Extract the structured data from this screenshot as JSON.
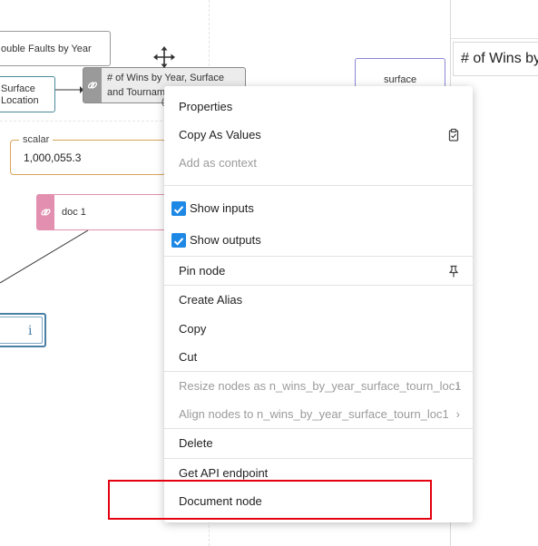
{
  "canvas": {
    "node_double_faults": "ouble Faults by Year",
    "node_surface_location_line1": "Surface",
    "node_surface_location_line2": "Location",
    "node_wins_line1": "# of Wins by Year, Surface",
    "node_wins_line2": "and Tournam",
    "node_wins_line3": "(",
    "node_surface": "surface",
    "scalar_label": "scalar",
    "scalar_value": "1,000,055.3",
    "doc_label": "doc 1",
    "info_glyph": "i"
  },
  "right_panel": {
    "title": "# of Wins by Year, Surface and Tournament Location"
  },
  "context_menu": {
    "properties": "Properties",
    "copy_as_values": "Copy As Values",
    "add_as_context": "Add as context",
    "show_inputs": "Show inputs",
    "show_outputs": "Show outputs",
    "pin_node": "Pin node",
    "create_alias": "Create Alias",
    "copy": "Copy",
    "cut": "Cut",
    "resize_nodes": "Resize nodes as n_wins_by_year_surface_tourn_loc1",
    "align_nodes": "Align nodes to n_wins_by_year_surface_tourn_loc1",
    "delete": "Delete",
    "get_api_endpoint": "Get API endpoint",
    "document_node": "Document node"
  },
  "colors": {
    "accent_blue": "#1e88e5",
    "scalar_border": "#d9a45a",
    "doc_border": "#e38fb0",
    "surface_node_border": "#8b86d8",
    "info_border": "#4a7fa6",
    "highlight_red": "#e3000f"
  },
  "icons": [
    "move-icon",
    "link-icon",
    "clipboard-icon",
    "checkbox-icon",
    "pin-icon",
    "chevron-right-icon",
    "info-icon"
  ]
}
